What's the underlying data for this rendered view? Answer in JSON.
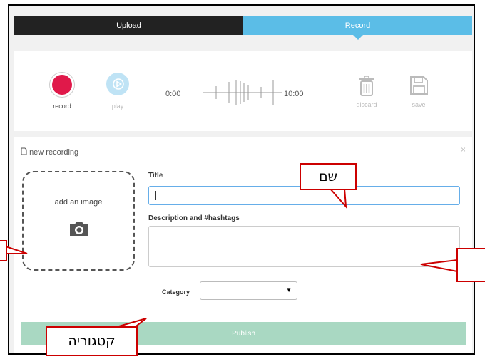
{
  "tabs": [
    {
      "label": "Upload",
      "active": false
    },
    {
      "label": "Record",
      "active": true
    }
  ],
  "recorder": {
    "record_label": "record",
    "play_label": "play",
    "time_start": "0:00",
    "time_end": "10:00",
    "discard_label": "discard",
    "save_label": "save",
    "record_color": "#e0194a",
    "accent_color": "#5bbde7"
  },
  "form": {
    "header": "new recording",
    "close": "×",
    "image_prompt": "add an image",
    "title_label": "Title",
    "title_value": "",
    "description_label": "Description and #hashtags",
    "description_value": "",
    "category_label": "Category",
    "category_value": "",
    "publish_label": "Publish"
  },
  "annotations": {
    "title_callout": "שם",
    "category_callout": "קטגוריה"
  },
  "icons": {
    "file": "file-icon",
    "camera": "camera-icon",
    "trash": "trash-icon",
    "floppy": "floppy-icon",
    "play": "play-icon"
  }
}
